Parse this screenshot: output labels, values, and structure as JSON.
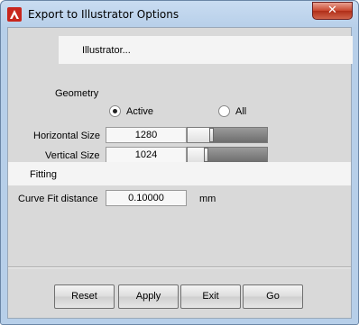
{
  "window": {
    "title": "Export to Illustrator Options",
    "close_glyph": "✕",
    "app_icon": "autocad-logo-icon",
    "app_icon_color": "#c8261d"
  },
  "header": {
    "text": "Illustrator..."
  },
  "geometry": {
    "label": "Geometry",
    "options": [
      {
        "label": "Active",
        "selected": true
      },
      {
        "label": "All",
        "selected": false
      }
    ]
  },
  "sizes": {
    "horizontal": {
      "label": "Horizontal Size",
      "value": "1280"
    },
    "vertical": {
      "label": "Vertical Size",
      "value": "1024"
    }
  },
  "fitting": {
    "section_label": "Fitting",
    "curve_fit": {
      "label": "Curve Fit distance",
      "value": "0.10000",
      "unit": "mm"
    }
  },
  "buttons": {
    "reset": "Reset",
    "apply": "Apply",
    "exit": "Exit",
    "go": "Go"
  }
}
